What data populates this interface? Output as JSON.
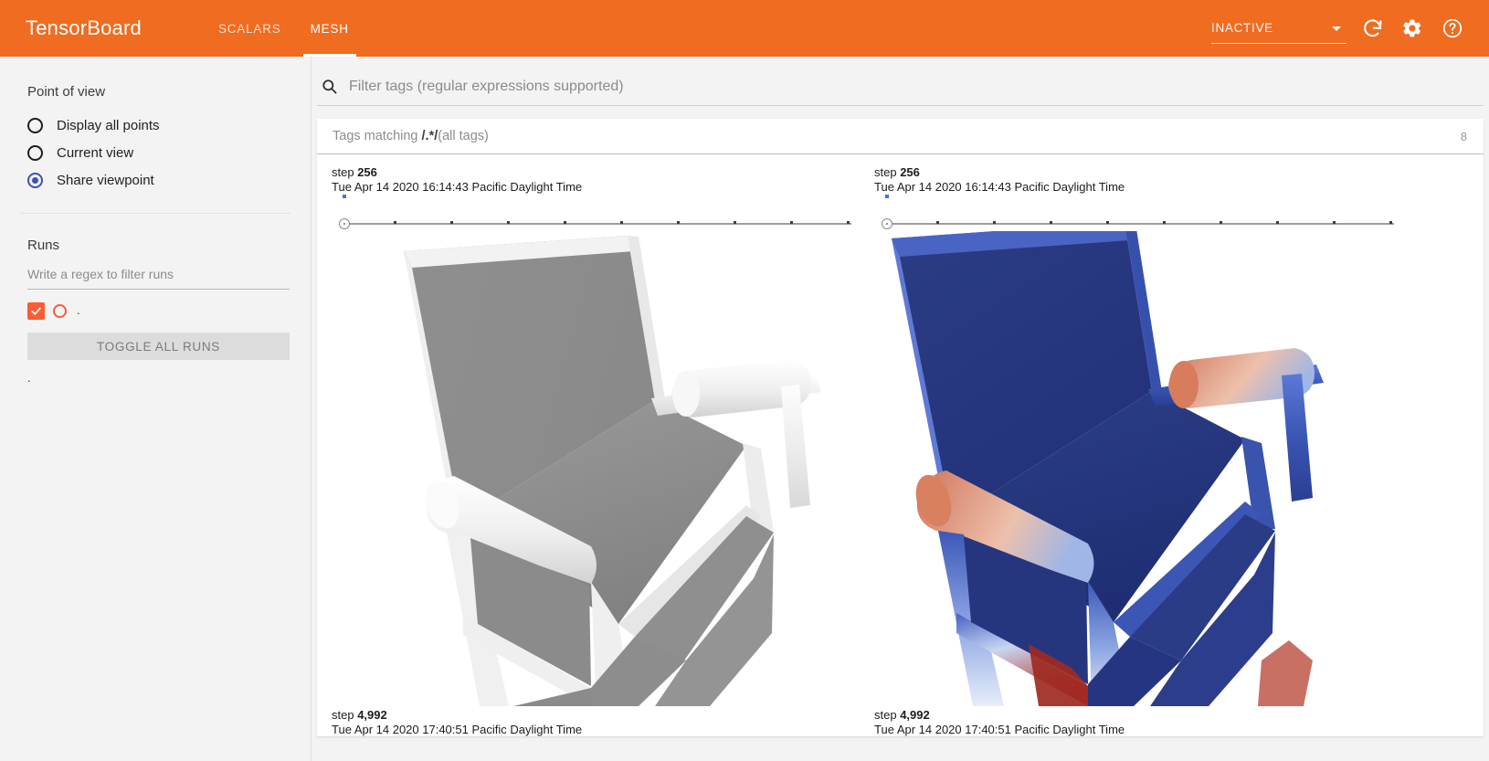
{
  "app": {
    "brand": "TensorBoard",
    "tabs": [
      {
        "label": "SCALARS",
        "active": false
      },
      {
        "label": "MESH",
        "active": true
      }
    ],
    "run_selector": {
      "value": "INACTIVE"
    },
    "icons": [
      "refresh-icon",
      "settings-gear-icon",
      "help-icon"
    ],
    "accent_color": "#ef6c21"
  },
  "sidebar": {
    "point_of_view": {
      "title": "Point of view",
      "options": [
        {
          "label": "Display all points",
          "selected": false
        },
        {
          "label": "Current view",
          "selected": false
        },
        {
          "label": "Share viewpoint",
          "selected": true
        }
      ],
      "selected_color": "#3f51b5"
    },
    "runs": {
      "title": "Runs",
      "filter_placeholder": "Write a regex to filter runs",
      "filter_value": "",
      "items": [
        {
          "name": ".",
          "checked": true,
          "color": "#fa5c35"
        }
      ],
      "toggle_label": "TOGGLE ALL RUNS",
      "trailing_text": "."
    }
  },
  "main": {
    "filter": {
      "placeholder": "Filter tags (regular expressions supported)",
      "value": ""
    },
    "tag_group": {
      "prefix": "Tags matching ",
      "regex": "/.*/",
      "suffix": "(all tags)",
      "count": "8"
    },
    "cards": [
      {
        "top_step_prefix": "step ",
        "top_step_value": "256",
        "top_date": "Tue Apr 14 2020 16:14:43 Pacific Daylight Time",
        "bottom_step_prefix": "step ",
        "bottom_step_value": "4,992",
        "bottom_date": "Tue Apr 14 2020 17:40:51 Pacific Daylight Time",
        "slider_position": 0,
        "slider_ticks": 9,
        "mesh_style": "grayscale"
      },
      {
        "top_step_prefix": "step ",
        "top_step_value": "256",
        "top_date": "Tue Apr 14 2020 16:14:43 Pacific Daylight Time",
        "bottom_step_prefix": "step ",
        "bottom_step_value": "4,992",
        "bottom_date": "Tue Apr 14 2020 17:40:51 Pacific Daylight Time",
        "slider_position": 0,
        "slider_ticks": 9,
        "mesh_style": "coolwarm"
      }
    ]
  }
}
